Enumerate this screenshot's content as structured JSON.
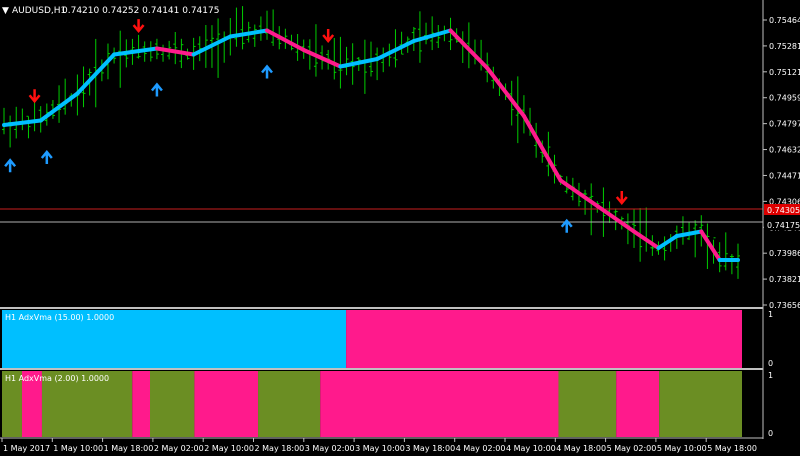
{
  "window": {
    "symbol_timeframe": "AUDUSD,H1",
    "ohlc": "0.74210 0.74252 0.74141 0.74175",
    "menu_icon": "triangle-down-icon"
  },
  "colors": {
    "background": "#000000",
    "separator": "#c0c0c0",
    "bar": "#00cc00",
    "adx_up": "#00bfff",
    "adx_down": "#ff1a8c",
    "adx_flat": "#6b8e23",
    "arrow_up": "#1e9bff",
    "arrow_down": "#ff1010",
    "bid_line": "#b0b0b0",
    "ask_line": "#c81e1e",
    "price_label_red": "#dd0000"
  },
  "price_axis": {
    "ticks": [
      "0.75464",
      "0.75281",
      "0.75121",
      "0.74959",
      "0.74797",
      "0.74632",
      "0.74471",
      "0.74306",
      "0.74146",
      "0.73986",
      "0.73821",
      "0.73656"
    ],
    "current_label": "0.74175",
    "ask_label": "0.74305"
  },
  "time_axis": {
    "ticks": [
      "1 May 2017",
      "1 May 10:00",
      "1 May 18:00",
      "2 May 02:00",
      "2 May 10:00",
      "2 May 18:00",
      "3 May 02:00",
      "3 May 10:00",
      "3 May 18:00",
      "4 May 02:00",
      "4 May 10:00",
      "4 May 18:00",
      "5 May 02:00",
      "5 May 10:00",
      "5 May 18:00"
    ]
  },
  "indicator1": {
    "label": "H1 AdxVma (15.00) 1.0000",
    "scale_top": "1",
    "scale_bottom": "0",
    "segments": [
      {
        "from": 0,
        "to": 0.465,
        "state": "up"
      },
      {
        "from": 0.465,
        "to": 1.0,
        "state": "down"
      }
    ]
  },
  "indicator2": {
    "label": "H1 AdxVma (2.00) 1.0000",
    "scale_top": "1",
    "scale_bottom": "0",
    "segments": [
      {
        "from": 0,
        "to": 0.027,
        "state": "flat"
      },
      {
        "from": 0.027,
        "to": 0.054,
        "state": "down"
      },
      {
        "from": 0.054,
        "to": 0.176,
        "state": "flat"
      },
      {
        "from": 0.176,
        "to": 0.2,
        "state": "down"
      },
      {
        "from": 0.2,
        "to": 0.26,
        "state": "flat"
      },
      {
        "from": 0.26,
        "to": 0.346,
        "state": "down"
      },
      {
        "from": 0.346,
        "to": 0.43,
        "state": "flat"
      },
      {
        "from": 0.43,
        "to": 0.752,
        "state": "down"
      },
      {
        "from": 0.752,
        "to": 0.83,
        "state": "flat"
      },
      {
        "from": 0.83,
        "to": 0.888,
        "state": "down"
      },
      {
        "from": 0.888,
        "to": 1.0,
        "state": "flat"
      }
    ]
  },
  "chart_data": {
    "type": "line",
    "title": "AUDUSD,H1",
    "ylim": [
      0.7358,
      0.7558
    ],
    "x": [
      0,
      6,
      12,
      18,
      25,
      31,
      37,
      43,
      49,
      55,
      61,
      67,
      73,
      79,
      85,
      91,
      97,
      103,
      107,
      110,
      114,
      117,
      120
    ],
    "series": [
      {
        "values": [
          0.7478,
          0.7481,
          0.7499,
          0.7525,
          0.7529,
          0.7525,
          0.7537,
          0.7541,
          0.7528,
          0.7517,
          0.7522,
          0.7534,
          0.7541,
          0.7516,
          0.7484,
          0.7441,
          0.7424,
          0.7407,
          0.7396,
          0.7404,
          0.7407,
          0.7388,
          0.7388
        ]
      }
    ],
    "arrows": [
      {
        "x": 1,
        "dir": "up"
      },
      {
        "x": 7,
        "dir": "up"
      },
      {
        "x": 5,
        "dir": "down"
      },
      {
        "x": 22,
        "dir": "down"
      },
      {
        "x": 25,
        "dir": "up"
      },
      {
        "x": 43,
        "dir": "up"
      },
      {
        "x": 53,
        "dir": "down"
      },
      {
        "x": 92,
        "dir": "up"
      },
      {
        "x": 101,
        "dir": "down"
      }
    ]
  }
}
